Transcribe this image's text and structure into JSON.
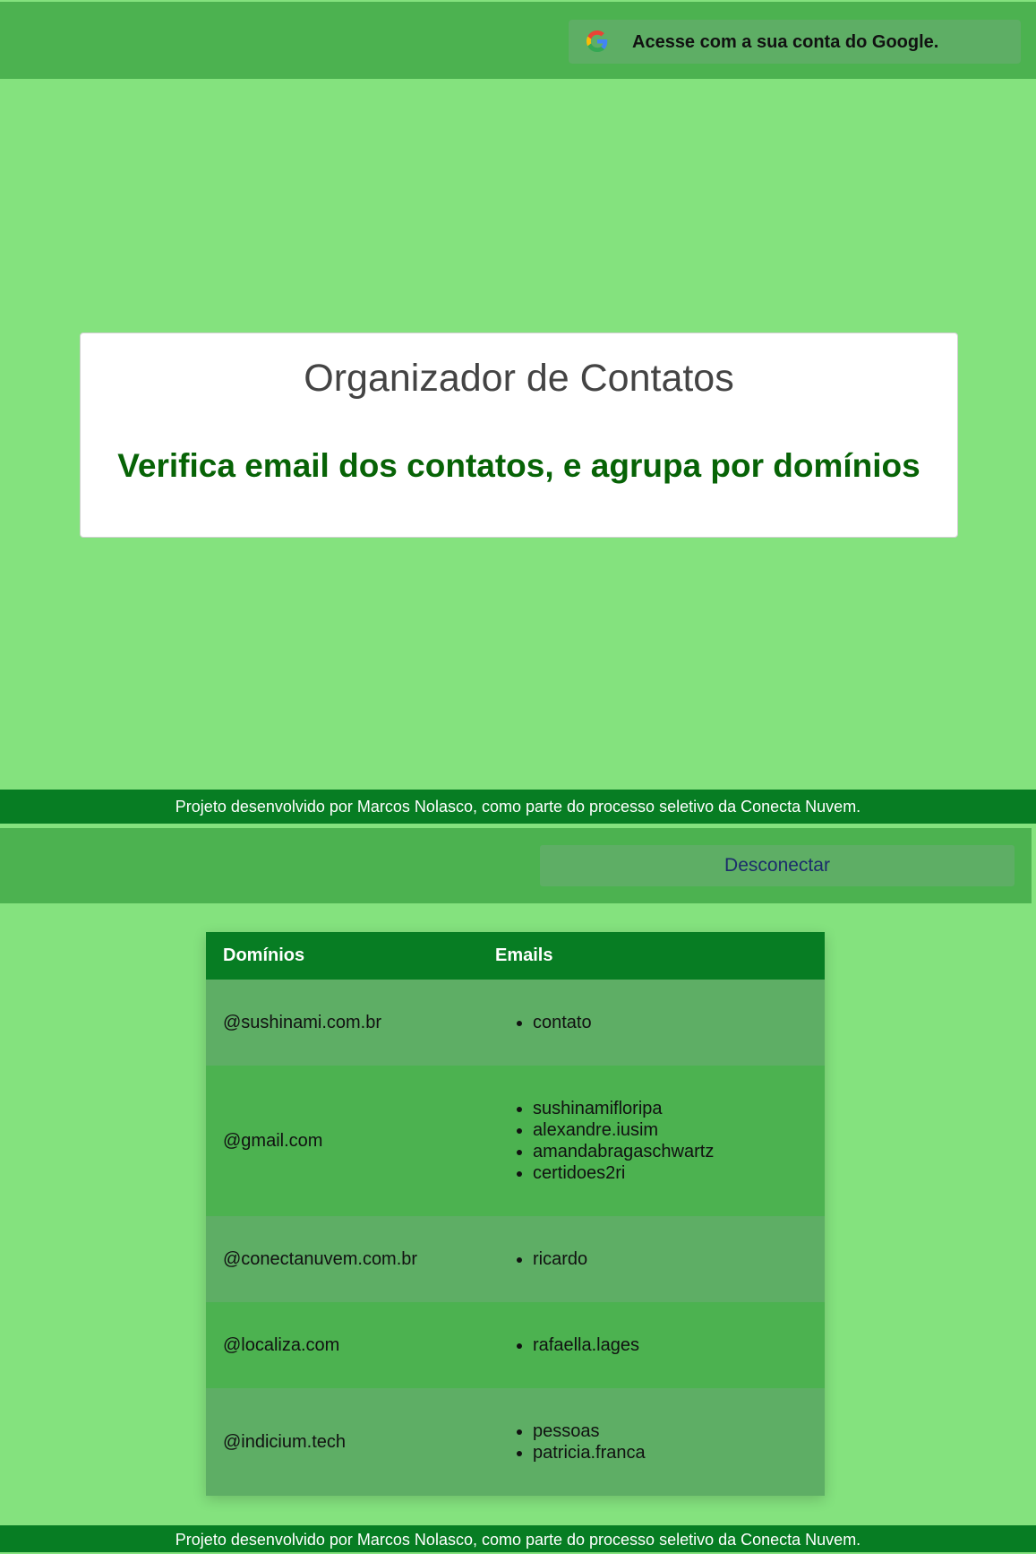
{
  "login_view": {
    "google_button": {
      "label": "Acesse com a sua conta do Google.",
      "icon": "google-icon"
    },
    "hero": {
      "title": "Organizador de Contatos",
      "subtitle": "Verifica email dos contatos, e agrupa por domínios"
    },
    "footer": "Projeto desenvolvido por Marcos Nolasco, como parte do processo seletivo da Conecta Nuvem."
  },
  "contacts_view": {
    "disconnect_label": "Desconectar",
    "table": {
      "headers": [
        "Domínios",
        "Emails"
      ],
      "rows": [
        {
          "domain": "@sushinami.com.br",
          "emails": [
            "contato"
          ]
        },
        {
          "domain": "@gmail.com",
          "emails": [
            "sushinamifloripa",
            "alexandre.iusim",
            "amandabragaschwartz",
            "certidoes2ri"
          ]
        },
        {
          "domain": "@conectanuvem.com.br",
          "emails": [
            "ricardo"
          ]
        },
        {
          "domain": "@localiza.com",
          "emails": [
            "rafaella.lages"
          ]
        },
        {
          "domain": "@indicium.tech",
          "emails": [
            "pessoas",
            "patricia.franca"
          ]
        }
      ]
    },
    "footer": "Projeto desenvolvido por Marcos Nolasco, como parte do processo seletivo da Conecta Nuvem."
  },
  "colors": {
    "page_background": "#84e27e",
    "header_background": "#4cb250",
    "button_background": "#5eae65",
    "footer_background": "#077d23",
    "subtitle_color": "#076306"
  }
}
